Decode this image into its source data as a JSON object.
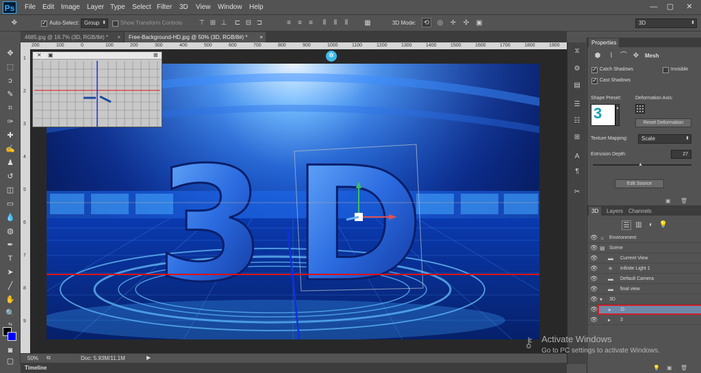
{
  "app": {
    "logo": "Ps"
  },
  "menu": [
    "File",
    "Edit",
    "Image",
    "Layer",
    "Type",
    "Select",
    "Filter",
    "3D",
    "View",
    "Window",
    "Help"
  ],
  "window_controls": {
    "minimize": "—",
    "restore": "▢",
    "close": "✕"
  },
  "options_bar": {
    "auto_select_label": "Auto-Select:",
    "auto_select_value": "Group",
    "show_transform_label": "Show Transform Controls",
    "mode_label": "3D Mode:",
    "workspace": "3D"
  },
  "tabs": [
    {
      "label": "4685.jpg @ 16.7% (3D, RGB/8#) *",
      "close": "×"
    },
    {
      "label": "Free-Background-HD.jpg @ 50% (3D, RGB/8#) *",
      "close": "×"
    }
  ],
  "ruler_top": [
    "200",
    "100",
    "0",
    "100",
    "200",
    "300",
    "400",
    "500",
    "600",
    "700",
    "800",
    "900",
    "1000",
    "1100",
    "1200",
    "1300",
    "1400",
    "1500",
    "1600",
    "1700",
    "1800",
    "1900"
  ],
  "ruler_left": [
    "1",
    "2",
    "3",
    "4",
    "5",
    "6",
    "7",
    "8",
    "9"
  ],
  "artwork": {
    "text_3": "3",
    "text_d": "D"
  },
  "status": {
    "zoom": "50%",
    "doc": "Doc: 5.93M/11.1M"
  },
  "timeline": {
    "label": "Timeline"
  },
  "properties": {
    "title": "Properties",
    "mode": "Mesh",
    "catch_shadows": "Catch Shadows",
    "invisible": "Invisible",
    "cast_shadows": "Cast Shadows",
    "shape_preset": "Shape Preset:",
    "shape_preview": "3",
    "deformation_axis": "Deformation Axis:",
    "reset_deformation": "Reset Deformation",
    "texture_mapping": "Texture Mapping:",
    "texture_value": "Scale",
    "extrusion_depth": "Extrusion Depth:",
    "extrusion_value": "27",
    "extrusion_fraction": 0.27,
    "edit_source": "Edit Source"
  },
  "layers_panel": {
    "tabs": [
      "3D",
      "Layers",
      "Channels"
    ],
    "rows": [
      {
        "name": "Environment",
        "indent": 0,
        "icon": "☼",
        "eye": true
      },
      {
        "name": "Scene",
        "indent": 0,
        "icon": "▤",
        "eye": true
      },
      {
        "name": "Current View",
        "indent": 1,
        "icon": "▬",
        "eye": true
      },
      {
        "name": "Infinite Light 1",
        "indent": 1,
        "icon": "☀",
        "eye": true
      },
      {
        "name": "Default Camera",
        "indent": 1,
        "icon": "▬",
        "eye": true
      },
      {
        "name": "final view",
        "indent": 1,
        "icon": "▬",
        "eye": true
      },
      {
        "name": "3D",
        "indent": 0,
        "icon": "▾",
        "eye": true
      },
      {
        "name": "D",
        "indent": 1,
        "icon": "▸",
        "eye": true,
        "selected": true
      },
      {
        "name": "3",
        "indent": 1,
        "icon": "▸",
        "eye": true
      }
    ]
  },
  "watermark": {
    "title": "Activate Windows",
    "subtitle": "Go to PC settings to activate Windows."
  },
  "colors": {
    "selection_outline": "#d0202a",
    "axis_red": "#e01010",
    "axis_blue": "#1030e0",
    "accent": "#31a8ff"
  }
}
